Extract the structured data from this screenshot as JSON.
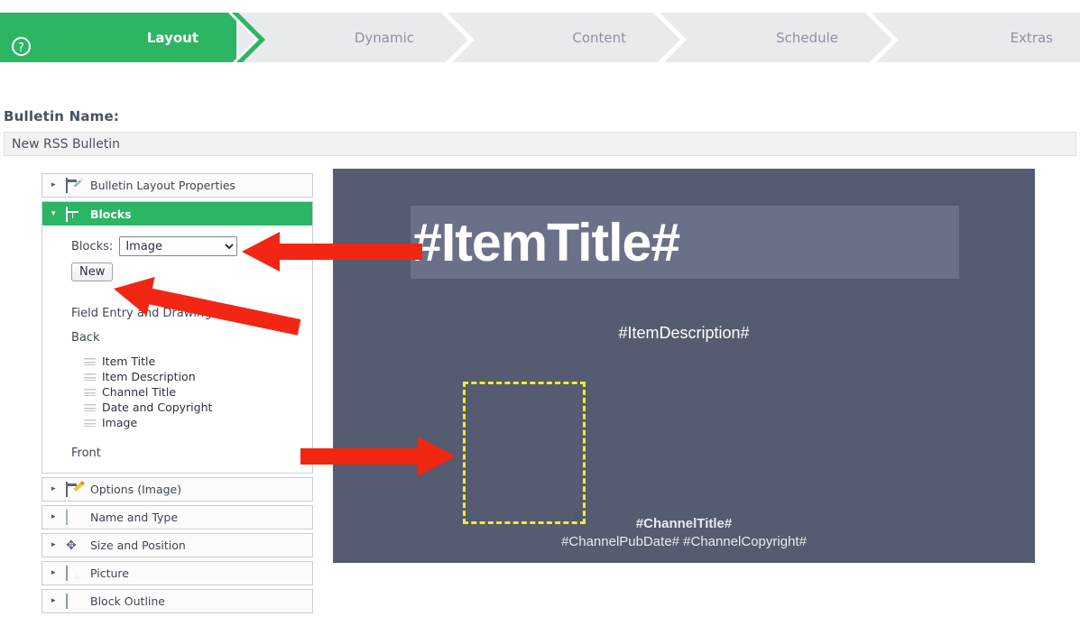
{
  "wizard": {
    "help_icon": "?",
    "steps": [
      {
        "label": "Layout",
        "active": true
      },
      {
        "label": "Dynamic",
        "active": false
      },
      {
        "label": "Content",
        "active": false
      },
      {
        "label": "Schedule",
        "active": false
      },
      {
        "label": "Extras",
        "active": false
      }
    ],
    "active_color": "#2cb563",
    "inactive_bg": "#e8eaec",
    "inactive_text": "#8d93a3"
  },
  "bulletin": {
    "label": "Bulletin Name:",
    "value": "New RSS Bulletin",
    "placeholder": "Bulletin Name"
  },
  "sidebar": {
    "items": [
      {
        "label": "Bulletin Layout Properties",
        "icon": "layout-properties-icon",
        "open": false
      },
      {
        "label": "Blocks",
        "icon": "blocks-icon",
        "open": true
      },
      {
        "label": "Options (Image)",
        "icon": "options-icon",
        "open": false
      },
      {
        "label": "Name and Type",
        "icon": "name-and-type-icon",
        "open": false
      },
      {
        "label": "Size and Position",
        "icon": "size-position-icon",
        "open": false
      },
      {
        "label": "Picture",
        "icon": "picture-icon",
        "open": false
      },
      {
        "label": "Block Outline",
        "icon": "block-outline-icon",
        "open": false
      }
    ],
    "caret_collapsed": "▸",
    "caret_expanded": "▾"
  },
  "blocks_panel": {
    "blocks_label": "Blocks:",
    "selected_block": "Image",
    "block_options": [
      "Image"
    ],
    "new_button": "New",
    "order_title": "Field Entry and Drawing Order:",
    "back_label": "Back",
    "front_label": "Front",
    "order_items": [
      "Item Title",
      "Item Description",
      "Channel Title",
      "Date and Copyright",
      "Image"
    ]
  },
  "preview": {
    "background_color": "#555b70",
    "title_band_color": "#6a7087",
    "item_title": "#ItemTitle#",
    "item_description": "#ItemDescription#",
    "channel_title": "#ChannelTitle#",
    "channel_meta": "#ChannelPubDate# #ChannelCopyright#",
    "image_block_outline_color": "#f5ee25"
  },
  "annotations": {
    "arrow_color": "#f22613",
    "arrows": [
      {
        "name": "arrow-to-blocks-dropdown",
        "points_to": "blocks-select"
      },
      {
        "name": "arrow-to-new-button",
        "points_to": "new-block-button"
      },
      {
        "name": "arrow-to-image-block",
        "points_to": "preview-image-block"
      }
    ]
  }
}
